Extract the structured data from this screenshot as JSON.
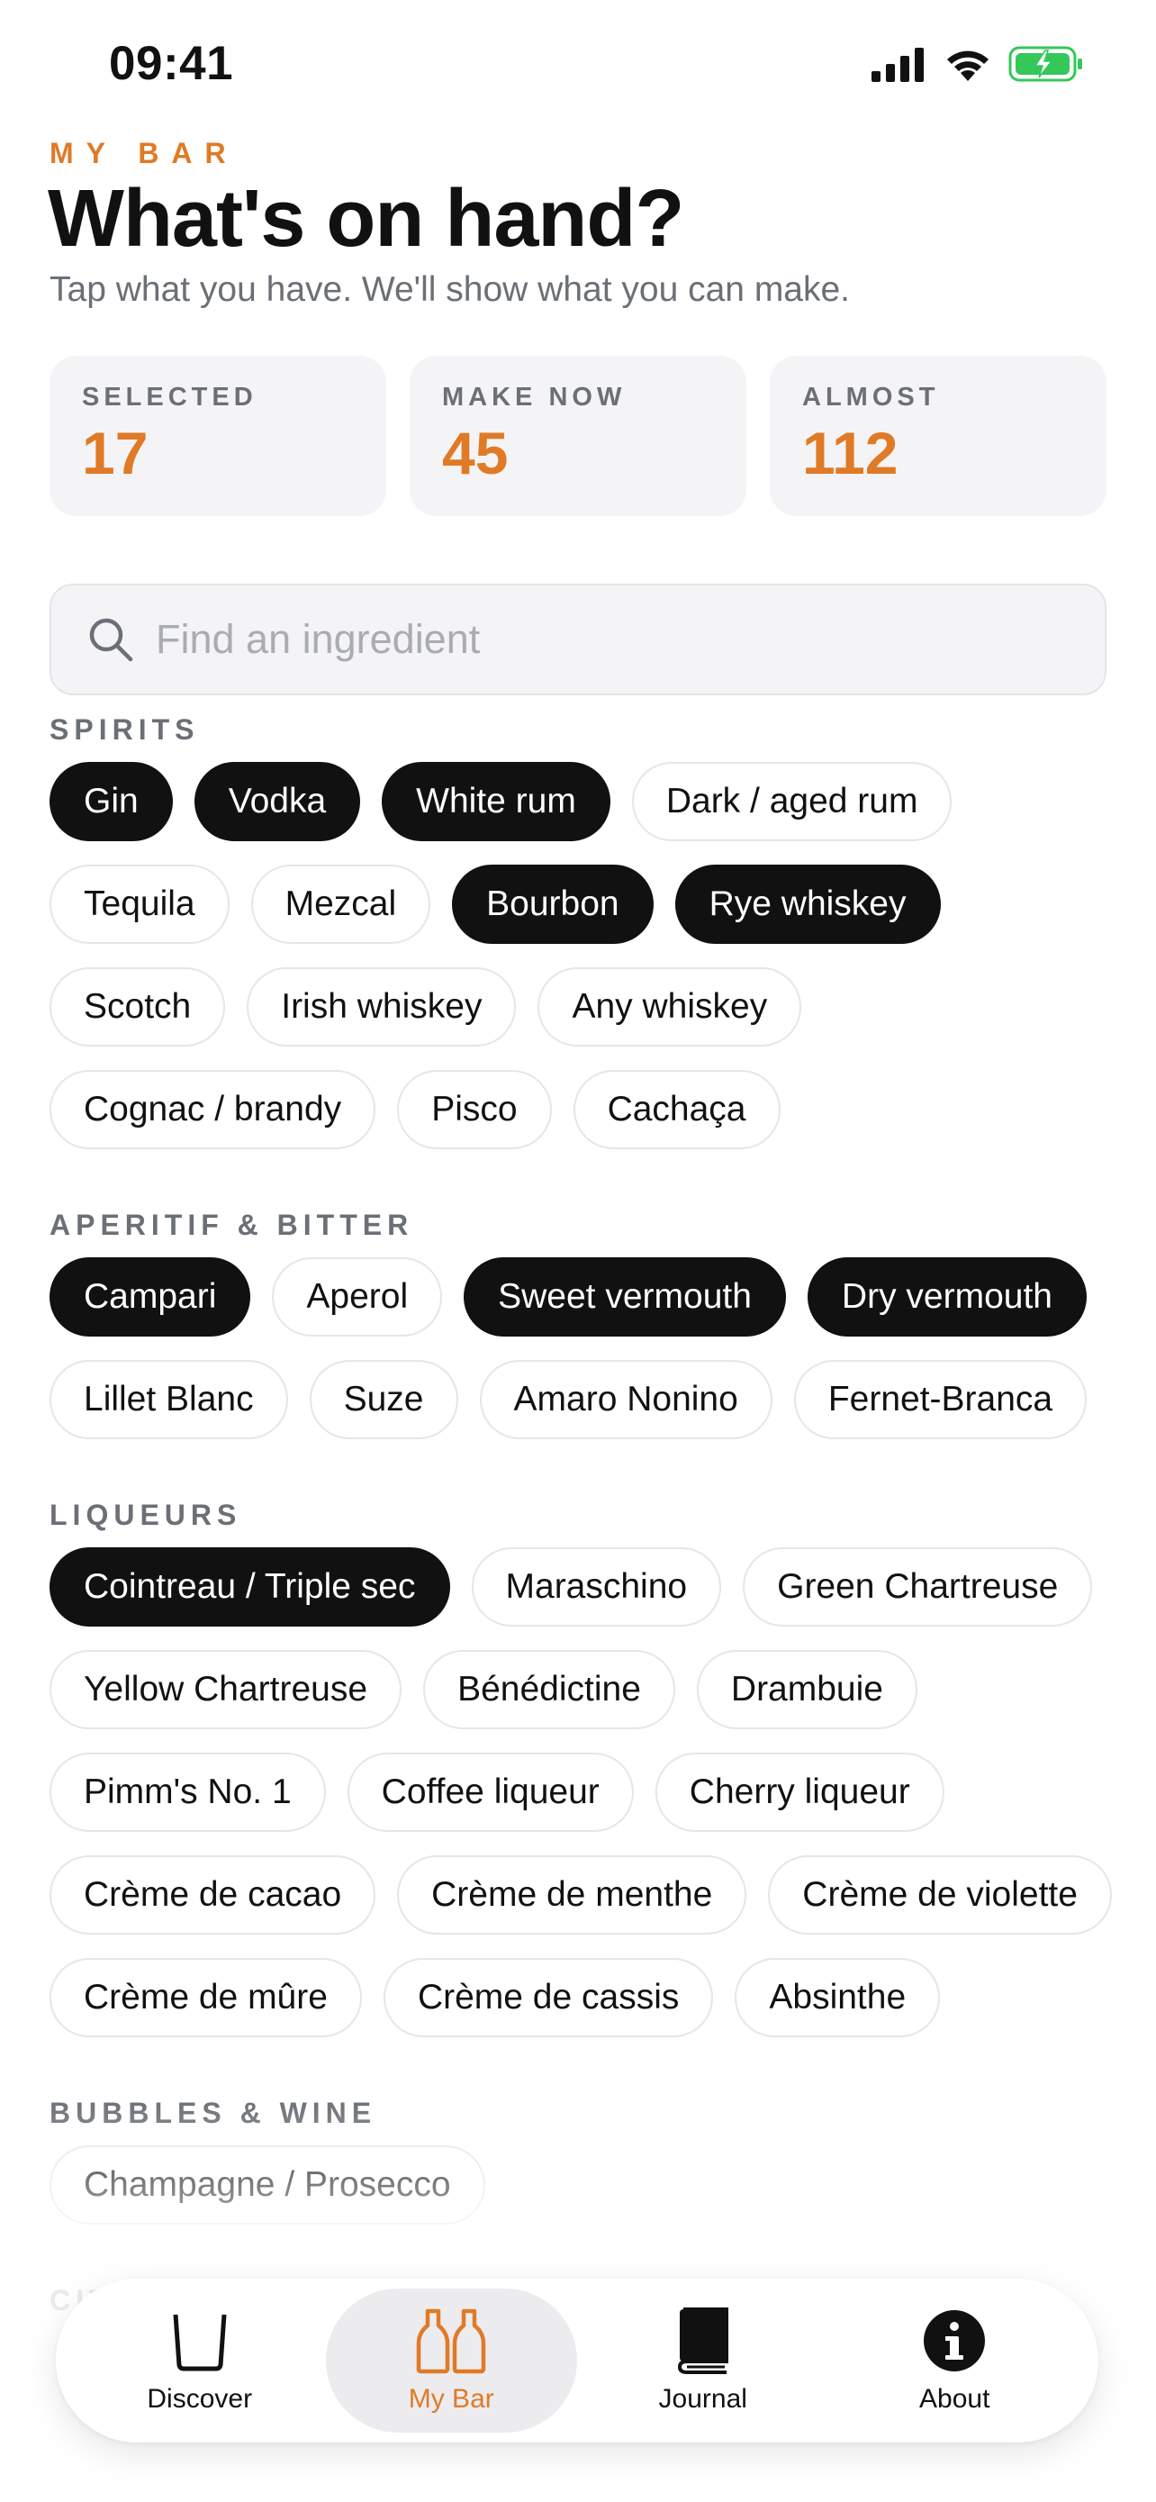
{
  "status_bar": {
    "time": "09:41"
  },
  "header": {
    "eyebrow": "MY BAR",
    "title": "What's on hand?",
    "subtitle": "Tap what you have. We'll show what you can make."
  },
  "stats": [
    {
      "label": "SELECTED",
      "value": "17"
    },
    {
      "label": "MAKE NOW",
      "value": "45"
    },
    {
      "label": "ALMOST",
      "value": "112"
    }
  ],
  "search": {
    "placeholder": "Find an ingredient",
    "value": ""
  },
  "sections": [
    {
      "label": "SPIRITS",
      "items": [
        {
          "label": "Gin",
          "selected": true
        },
        {
          "label": "Vodka",
          "selected": true
        },
        {
          "label": "White rum",
          "selected": true
        },
        {
          "label": "Dark / aged rum",
          "selected": false
        },
        {
          "label": "Tequila",
          "selected": false
        },
        {
          "label": "Mezcal",
          "selected": false
        },
        {
          "label": "Bourbon",
          "selected": true
        },
        {
          "label": "Rye whiskey",
          "selected": true
        },
        {
          "label": "Scotch",
          "selected": false
        },
        {
          "label": "Irish whiskey",
          "selected": false
        },
        {
          "label": "Any whiskey",
          "selected": false
        },
        {
          "label": "Cognac / brandy",
          "selected": false
        },
        {
          "label": "Pisco",
          "selected": false
        },
        {
          "label": "Cachaça",
          "selected": false
        }
      ]
    },
    {
      "label": "APERITIF & BITTER",
      "items": [
        {
          "label": "Campari",
          "selected": true
        },
        {
          "label": "Aperol",
          "selected": false
        },
        {
          "label": "Sweet vermouth",
          "selected": true
        },
        {
          "label": "Dry vermouth",
          "selected": true
        },
        {
          "label": "Lillet Blanc",
          "selected": false
        },
        {
          "label": "Suze",
          "selected": false
        },
        {
          "label": "Amaro Nonino",
          "selected": false
        },
        {
          "label": "Fernet-Branca",
          "selected": false
        }
      ]
    },
    {
      "label": "LIQUEURS",
      "items": [
        {
          "label": "Cointreau / Triple sec",
          "selected": true
        },
        {
          "label": "Maraschino",
          "selected": false
        },
        {
          "label": "Green Chartreuse",
          "selected": false
        },
        {
          "label": "Yellow Chartreuse",
          "selected": false
        },
        {
          "label": "Bénédictine",
          "selected": false
        },
        {
          "label": "Drambuie",
          "selected": false
        },
        {
          "label": "Pimm's No. 1",
          "selected": false
        },
        {
          "label": "Coffee liqueur",
          "selected": false
        },
        {
          "label": "Cherry liqueur",
          "selected": false
        },
        {
          "label": "Crème de cacao",
          "selected": false
        },
        {
          "label": "Crème de menthe",
          "selected": false
        },
        {
          "label": "Crème de violette",
          "selected": false
        },
        {
          "label": "Crème de mûre",
          "selected": false
        },
        {
          "label": "Crème de cassis",
          "selected": false
        },
        {
          "label": "Absinthe",
          "selected": false
        }
      ]
    },
    {
      "label": "BUBBLES & WINE",
      "items": [
        {
          "label": "Champagne / Prosecco",
          "selected": false
        }
      ]
    },
    {
      "label": "CITRUS",
      "items": []
    }
  ],
  "tab_bar": {
    "tabs": [
      {
        "label": "Discover",
        "icon": "glass-icon",
        "active": false
      },
      {
        "label": "My Bar",
        "icon": "bottles-icon",
        "active": true
      },
      {
        "label": "Journal",
        "icon": "book-icon",
        "active": false
      },
      {
        "label": "About",
        "icon": "info-icon",
        "active": false
      }
    ]
  },
  "colors": {
    "accent": "#E07A26",
    "chip_selected_bg": "#111111",
    "chip_border": "#E6E6EA",
    "card_bg": "#F4F4F6",
    "muted_text": "#6B6F76",
    "battery_green": "#34C759"
  }
}
